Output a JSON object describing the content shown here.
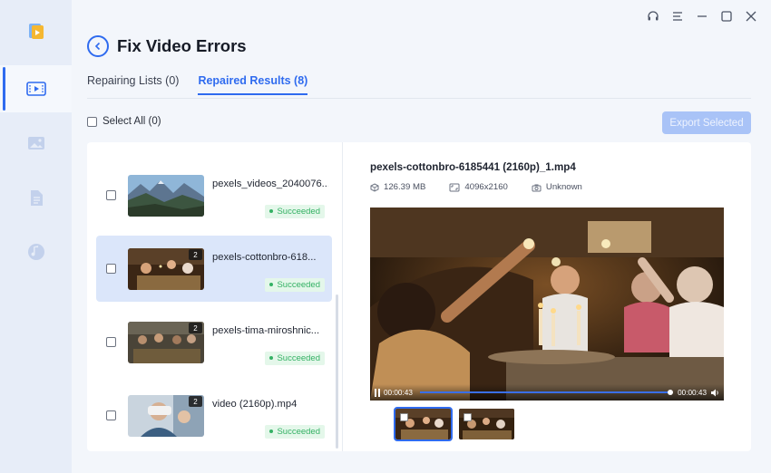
{
  "sidebar": {
    "items": [
      {
        "name": "app-logo",
        "icon": "app-logo-icon"
      },
      {
        "name": "video-repair",
        "icon": "video-repair-icon",
        "active": true
      },
      {
        "name": "photo-repair",
        "icon": "image-icon"
      },
      {
        "name": "file-repair",
        "icon": "document-icon"
      },
      {
        "name": "audio-repair",
        "icon": "music-icon"
      }
    ]
  },
  "window": {
    "controls": [
      "headset-icon",
      "menu-icon",
      "minimize-icon",
      "maximize-icon",
      "close-icon"
    ]
  },
  "header": {
    "title": "Fix Video Errors"
  },
  "tabs": [
    {
      "label": "Repairing Lists (0)",
      "active": false
    },
    {
      "label": "Repaired Results (8)",
      "active": true
    }
  ],
  "toolbar": {
    "select_all_label": "Select All (0)",
    "export_label": "Export Selected"
  },
  "files": [
    {
      "name": "pexels_videos_2040076...",
      "status": "Succeeded",
      "badge": ""
    },
    {
      "name": "pexels-cottonbro-618...",
      "status": "Succeeded",
      "badge": "2"
    },
    {
      "name": "pexels-tima-miroshnic...",
      "status": "Succeeded",
      "badge": "2"
    },
    {
      "name": "video (2160p).mp4",
      "status": "Succeeded",
      "badge": "2"
    }
  ],
  "detail": {
    "file_name": "pexels-cottonbro-6185441 (2160p)_1.mp4",
    "size": "126.39 MB",
    "resolution": "4096x2160",
    "device": "Unknown",
    "player": {
      "current_time": "00:00:43",
      "duration": "00:00:43",
      "progress": 1.0
    }
  },
  "colors": {
    "accent": "#2f6bef",
    "success": "#34b164",
    "export_disabled": "#a9c3f7"
  }
}
